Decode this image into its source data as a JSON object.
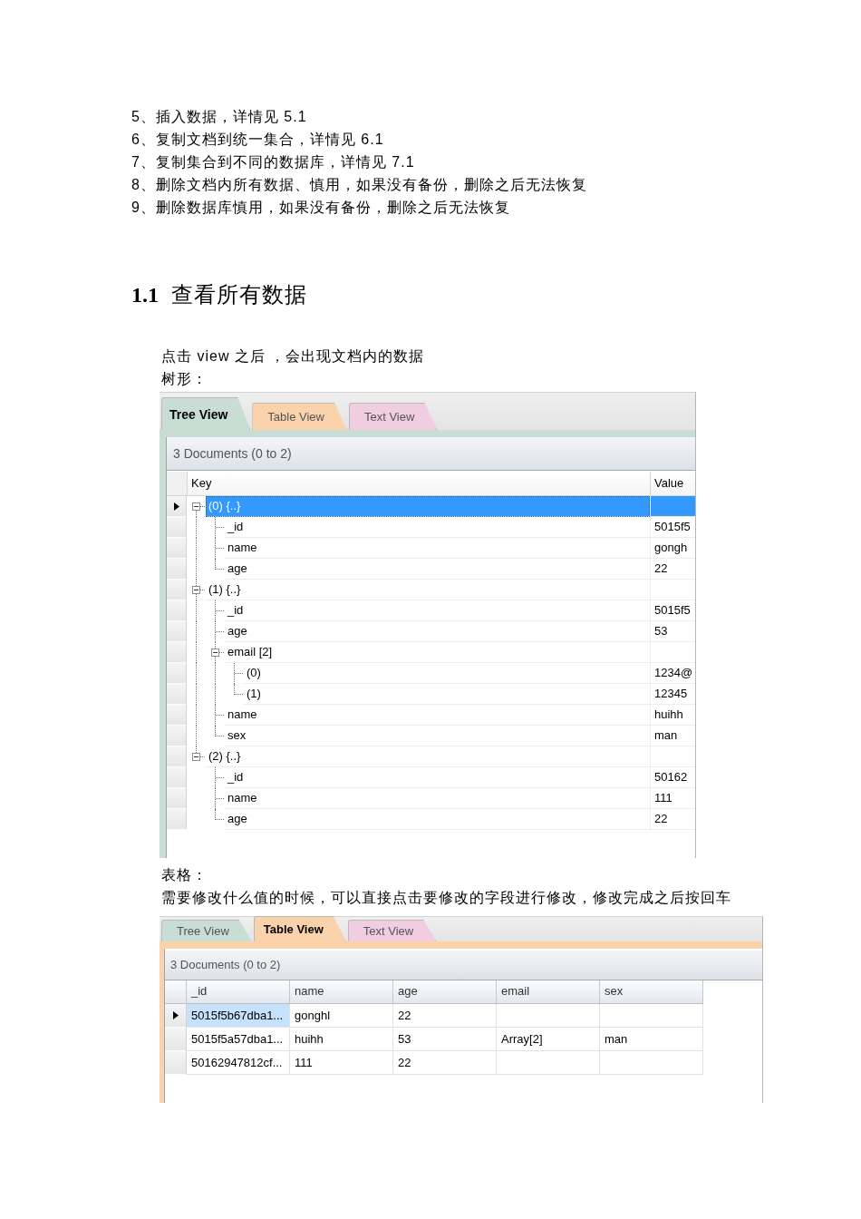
{
  "list_items": [
    "5、插入数据，详情见 5.1",
    "6、复制文档到统一集合，详情见 6.1",
    "7、复制集合到不同的数据库，详情见 7.1",
    "8、删除文档内所有数据、慎用，如果没有备份，删除之后无法恢复",
    "9、删除数据库慎用，如果没有备份，删除之后无法恢复"
  ],
  "section": {
    "number": "1.1",
    "title": "查看所有数据"
  },
  "intro": [
    "点击 view 之后 ，会出现文档内的数据",
    "树形："
  ],
  "tree_view_window": {
    "tabs": [
      {
        "label": "Tree View",
        "selected": true,
        "color": "#c8ddd4"
      },
      {
        "label": "Table View",
        "selected": false,
        "color": "#fad2ab"
      },
      {
        "label": "Text View",
        "selected": false,
        "color": "#f0cde0"
      }
    ],
    "summary": "3 Documents (0 to 2)",
    "columns": [
      "Key",
      "Value"
    ],
    "nodes": [
      {
        "key": "(0) {..}",
        "selected": true,
        "expanded": true,
        "children": [
          {
            "key": "_id",
            "value": "5015f5",
            "selected": false
          },
          {
            "key": "name",
            "value": "gongh",
            "selected": false
          },
          {
            "key": "age",
            "value": "22",
            "selected": false
          }
        ]
      },
      {
        "key": "(1) {..}",
        "selected": false,
        "expanded": true,
        "children": [
          {
            "key": "_id",
            "value": "5015f5",
            "selected": false
          },
          {
            "key": "age",
            "value": "53",
            "selected": false
          },
          {
            "key": "email [2]",
            "selected": false,
            "expanded": true,
            "children": [
              {
                "key": "(0)",
                "value": "1234@",
                "selected": false
              },
              {
                "key": "(1)",
                "value": "12345",
                "selected": false
              }
            ]
          },
          {
            "key": "name",
            "value": "huihh",
            "selected": false
          },
          {
            "key": "sex",
            "value": "man",
            "selected": false
          }
        ]
      },
      {
        "key": "(2) {..}",
        "selected": false,
        "expanded": true,
        "children": [
          {
            "key": "_id",
            "value": "50162",
            "selected": false
          },
          {
            "key": "name",
            "value": "111",
            "selected": false
          },
          {
            "key": "age",
            "value": "22",
            "selected": false
          }
        ]
      }
    ]
  },
  "table_intro": [
    "表格：",
    "需要修改什么值的时候，可以直接点击要修改的字段进行修改，修改完成之后按回车"
  ],
  "table_view_window": {
    "tabs": [
      {
        "label": "Tree View",
        "selected": false,
        "color": "#c8ddd4"
      },
      {
        "label": "Table View",
        "selected": true,
        "color": "#fad2ab"
      },
      {
        "label": "Text View",
        "selected": false,
        "color": "#f0cde0"
      }
    ],
    "summary": "3 Documents (0 to 2)",
    "columns": [
      "_id",
      "name",
      "age",
      "email",
      "sex"
    ],
    "rows": [
      {
        "selected": true,
        "id": "5015f5b67dba1...",
        "name": "gonghl",
        "age": "22"
      },
      {
        "selected": false,
        "id": "5015f5a57dba1...",
        "name": "huihh",
        "age": "53",
        "email": "Array[2]",
        "sex": "man"
      },
      {
        "selected": false,
        "id": "50162947812cf...",
        "name": "111",
        "age": "22"
      }
    ]
  }
}
